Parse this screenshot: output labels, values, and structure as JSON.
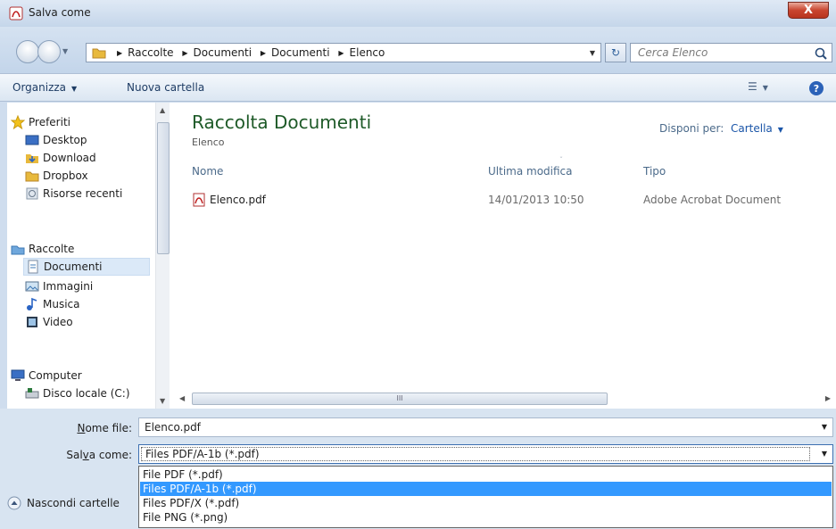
{
  "window": {
    "title": "Salva come",
    "close_label": "X"
  },
  "nav": {
    "breadcrumbs": [
      "Raccolte",
      "Documenti",
      "Documenti",
      "Elenco"
    ],
    "search_placeholder": "Cerca Elenco"
  },
  "toolbar": {
    "organize_label": "Organizza",
    "new_folder_label": "Nuova cartella"
  },
  "sidebar": {
    "favorites": {
      "label": "Preferiti",
      "items": [
        "Desktop",
        "Download",
        "Dropbox",
        "Risorse recenti"
      ]
    },
    "libraries": {
      "label": "Raccolte",
      "items": [
        "Documenti",
        "Immagini",
        "Musica",
        "Video"
      ],
      "selected": "Documenti"
    },
    "computer": {
      "label": "Computer",
      "items": [
        "Disco locale (C:)"
      ]
    }
  },
  "main": {
    "library_title": "Raccolta Documenti",
    "library_subtitle": "Elenco",
    "arrange_label": "Disponi per:",
    "arrange_value": "Cartella",
    "columns": [
      "Nome",
      "Ultima modifica",
      "Tipo"
    ],
    "files": [
      {
        "name": "Elenco.pdf",
        "modified": "14/01/2013 10:50",
        "type": "Adobe Acrobat Document"
      }
    ],
    "hscroll_grip": "III"
  },
  "form": {
    "file_name_label_prefix": "N",
    "file_name_label_rest": "ome file:",
    "file_name_value": "Elenco.pdf",
    "save_as_label_prefix": "Sal",
    "save_as_label_accel": "v",
    "save_as_label_rest": "a come:",
    "save_as_value": "Files PDF/A-1b (*.pdf)",
    "save_as_options": [
      "File PDF (*.pdf)",
      "Files PDF/A-1b (*.pdf)",
      "Files PDF/X (*.pdf)",
      "File PNG (*.png)"
    ],
    "save_as_selected": 1,
    "hide_folders_label": "Nascondi cartelle"
  },
  "colors": {
    "accent": "#3399ff",
    "library_title": "#1e5a28",
    "link": "#1a55a8"
  }
}
